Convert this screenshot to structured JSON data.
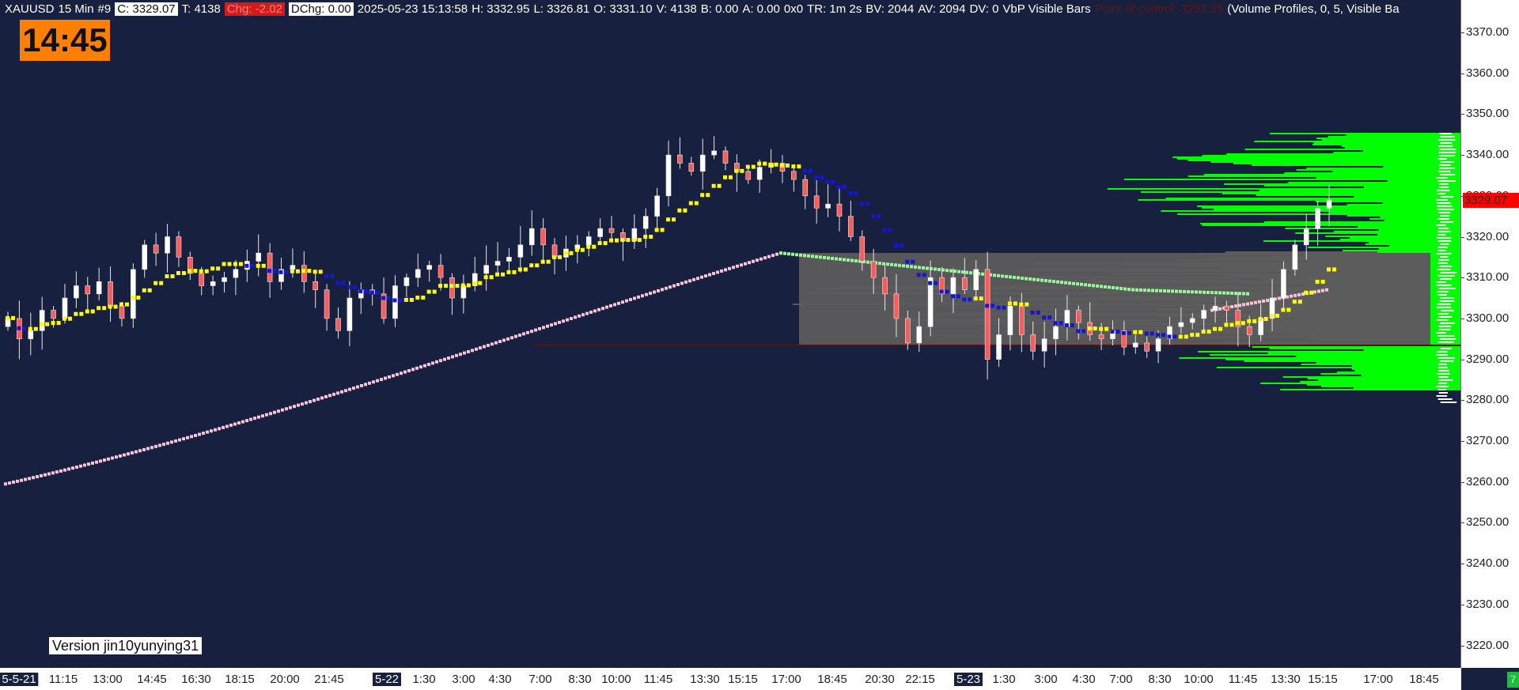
{
  "header": {
    "symbol": "XAUUSD",
    "timeframe": "15 Min",
    "bar_index": "#9",
    "close_box": "C: 3329.07",
    "ticks": "T: 4138",
    "change_box": "Chg: -2.02",
    "dchange_box": "DChg: 0.00",
    "datetime": "2025-05-23 15:13:58",
    "high": "H: 3332.95",
    "low": "L: 3326.81",
    "open": "O: 3331.10",
    "volume": "V: 4138",
    "bid": "B: 0.00",
    "ask": "A: 0.00",
    "flags": "0x0",
    "time_remaining": "TR: 1m 2s",
    "bid_volume": "BV: 2044",
    "ask_volume": "AV: 2094",
    "delta_volume": "DV: 0",
    "vbp": "VbP Visible Bars",
    "poc": "Point of control: 3293.35",
    "profile": "(Volume Profiles, 0, 5, Visible Ba"
  },
  "clock": "14:45",
  "version": "Version jin10yunying31",
  "current_price": "3329.07",
  "corner_badge": "7",
  "price_axis": {
    "labels": [
      "3370.00",
      "3360.00",
      "3350.00",
      "3340.00",
      "3330.00",
      "3320.00",
      "3310.00",
      "3300.00",
      "3290.00",
      "3280.00",
      "3270.00",
      "3260.00",
      "3250.00",
      "3240.00",
      "3230.00",
      "3220.00"
    ]
  },
  "time_axis": {
    "labels": [
      {
        "t": "5-5-21",
        "date": true
      },
      {
        "t": "11:15"
      },
      {
        "t": "13:00"
      },
      {
        "t": "14:45"
      },
      {
        "t": "16:30"
      },
      {
        "t": "18:15"
      },
      {
        "t": "20:00"
      },
      {
        "t": "21:45"
      },
      {
        "t": "5-22",
        "date": true
      },
      {
        "t": "1:30"
      },
      {
        "t": "3:00"
      },
      {
        "t": "4:30"
      },
      {
        "t": "7:00"
      },
      {
        "t": "8:30"
      },
      {
        "t": "10:00"
      },
      {
        "t": "11:45"
      },
      {
        "t": "13:30"
      },
      {
        "t": "15:15"
      },
      {
        "t": "17:00"
      },
      {
        "t": "18:45"
      },
      {
        "t": "20:30"
      },
      {
        "t": "22:15"
      },
      {
        "t": "5-23",
        "date": true
      },
      {
        "t": "1:30"
      },
      {
        "t": "3:00"
      },
      {
        "t": "4:30"
      },
      {
        "t": "7:00"
      },
      {
        "t": "8:30"
      },
      {
        "t": "10:00"
      },
      {
        "t": "11:45"
      },
      {
        "t": "13:30"
      },
      {
        "t": "15:15"
      },
      {
        "t": "17:00"
      },
      {
        "t": "18:45"
      }
    ]
  },
  "colors": {
    "up": "#ffffff",
    "down": "#ff5a5a",
    "ma_fast": "#ffff00",
    "ma_fast_down": "#1515d8",
    "ma_slow": "#f7c3d6",
    "ma_mid": "#98f898",
    "profile_gray": "#5c5c5c",
    "profile_green": "#00ff00"
  },
  "chart_data": {
    "type": "candlestick",
    "ylim": [
      3215,
      3375
    ],
    "close_series": [
      3300,
      3295,
      3297,
      3302,
      3300,
      3305,
      3308,
      3306,
      3309,
      3303,
      3300,
      3312,
      3318,
      3316,
      3320,
      3315,
      3311,
      3308,
      3309,
      3310,
      3312,
      3314,
      3316,
      3309,
      3312,
      3313,
      3309,
      3307,
      3300,
      3297,
      3305,
      3307,
      3306,
      3300,
      3308,
      3310,
      3312,
      3313,
      3310,
      3305,
      3308,
      3311,
      3313,
      3314,
      3315,
      3318,
      3322,
      3318,
      3315,
      3317,
      3318,
      3320,
      3322,
      3321,
      3319,
      3322,
      3325,
      3330,
      3340,
      3338,
      3336,
      3340,
      3341,
      3338,
      3336,
      3334,
      3337,
      3338,
      3336,
      3334,
      3330,
      3327,
      3328,
      3325,
      3320,
      3314,
      3310,
      3306,
      3300,
      3294,
      3298,
      3310,
      3306,
      3310,
      3307,
      3312,
      3290,
      3296,
      3303,
      3296,
      3292,
      3295,
      3298,
      3302,
      3299,
      3296,
      3295,
      3297,
      3293,
      3294,
      3292,
      3295,
      3298,
      3299,
      3300,
      3302,
      3303,
      3302,
      3298,
      3296,
      3300,
      3305,
      3312,
      3318,
      3322,
      3327,
      3329
    ]
  }
}
